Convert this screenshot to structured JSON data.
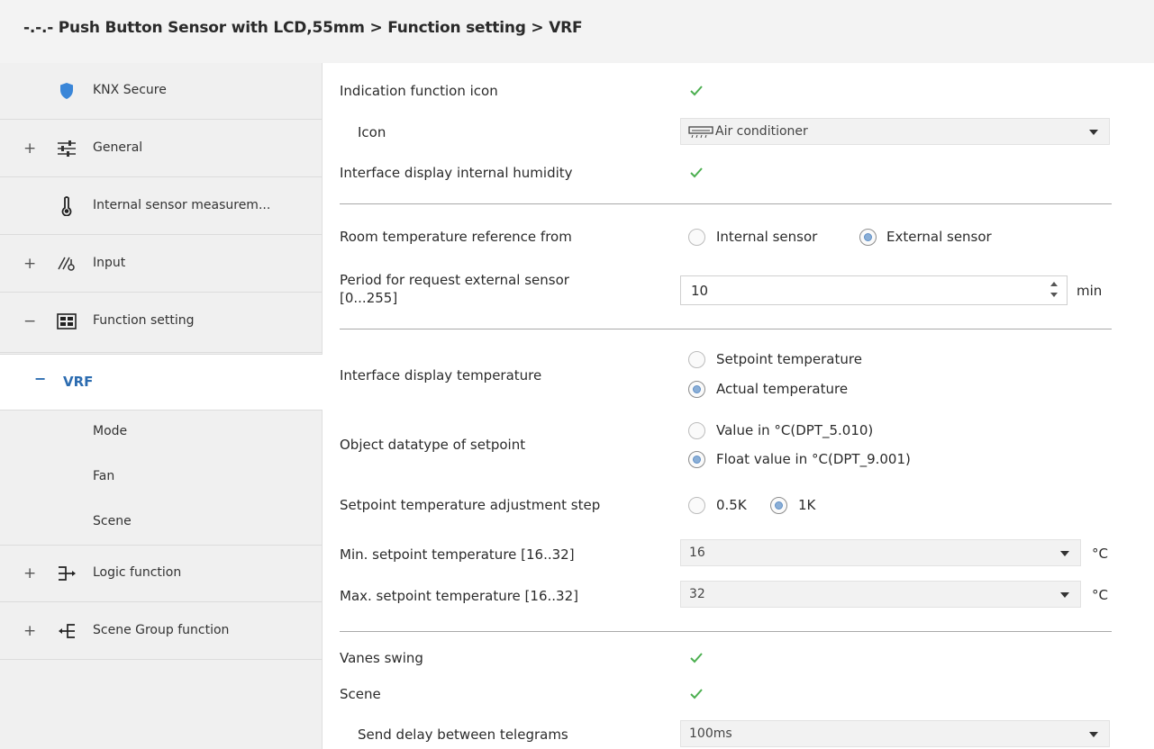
{
  "header": {
    "title": "-.-.- Push Button Sensor with LCD,55mm > Function setting > VRF"
  },
  "sidebar": {
    "items": [
      {
        "label": "KNX Secure",
        "expander": "",
        "icon": "shield-icon"
      },
      {
        "label": "General",
        "expander": "+",
        "icon": "sliders-icon"
      },
      {
        "label": "Internal sensor measurem...",
        "expander": "",
        "icon": "thermometer-icon"
      },
      {
        "label": "Input",
        "expander": "+",
        "icon": "input-icon"
      },
      {
        "label": "Function setting",
        "expander": "−",
        "icon": "function-grid-icon"
      }
    ],
    "active": {
      "expander": "−",
      "label": "VRF"
    },
    "subitems": [
      "Mode",
      "Fan",
      "Scene"
    ],
    "bottom_items": [
      {
        "label": "Logic function",
        "expander": "+",
        "icon": "logic-icon"
      },
      {
        "label": "Scene Group function",
        "expander": "+",
        "icon": "scene-group-icon"
      }
    ]
  },
  "params": {
    "indication_icon": {
      "label": "Indication function icon",
      "checked": true
    },
    "icon": {
      "label": "Icon",
      "value": "Air conditioner",
      "icon": "air-conditioner-icon"
    },
    "display_humidity": {
      "label": "Interface display internal humidity",
      "checked": true
    },
    "room_temp_ref": {
      "label": "Room temperature reference from",
      "options": [
        "Internal sensor",
        "External sensor"
      ],
      "selected": "External sensor"
    },
    "request_period": {
      "label_line1": "Period for request external sensor",
      "label_line2": "[0...255]",
      "value": "10",
      "unit": "min"
    },
    "display_temp": {
      "label": "Interface display temperature",
      "options": [
        "Setpoint temperature",
        "Actual temperature"
      ],
      "selected": "Actual temperature"
    },
    "setpoint_datatype": {
      "label": "Object datatype of setpoint",
      "options": [
        "Value in °C(DPT_5.010)",
        "Float value in °C(DPT_9.001)"
      ],
      "selected": "Float value in °C(DPT_9.001)"
    },
    "adjust_step": {
      "label": "Setpoint temperature adjustment step",
      "options": [
        "0.5K",
        "1K"
      ],
      "selected": "1K"
    },
    "min_setpoint": {
      "label": "Min. setpoint temperature [16..32]",
      "value": "16",
      "unit": "°C"
    },
    "max_setpoint": {
      "label": "Max. setpoint temperature [16..32]",
      "value": "32",
      "unit": "°C"
    },
    "vanes_swing": {
      "label": "Vanes swing",
      "checked": true
    },
    "scene": {
      "label": "Scene",
      "checked": true
    },
    "send_delay": {
      "label": "Send delay between telegrams",
      "value": "100ms"
    }
  },
  "colors": {
    "accent": "#2c6cb0",
    "check": "#4caf50",
    "sidebar_bg": "#f0f0f0",
    "header_bg": "#f3f3f3"
  }
}
